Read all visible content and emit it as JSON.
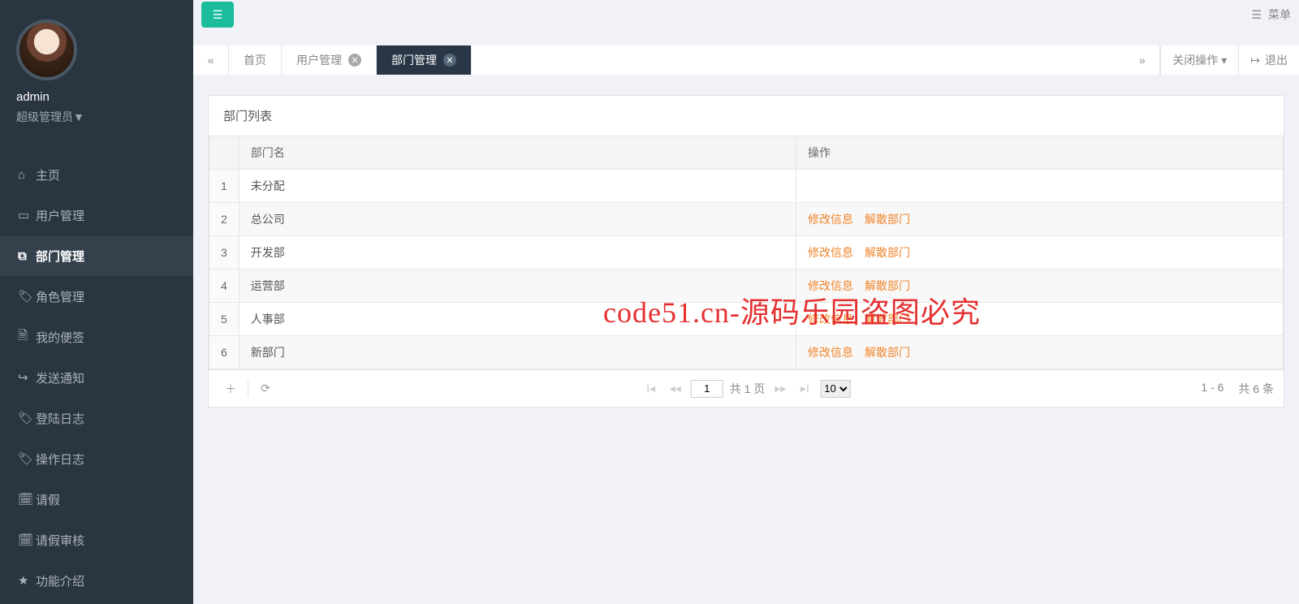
{
  "sidebar": {
    "username": "admin",
    "role": "超级管理员▼",
    "nav": [
      {
        "icon": "⌂",
        "label": "主页"
      },
      {
        "icon": "▭",
        "label": "用户管理"
      },
      {
        "icon": "⧉",
        "label": "部门管理",
        "active": true
      },
      {
        "icon": "🏷",
        "label": "角色管理"
      },
      {
        "icon": "🗎",
        "label": "我的便签"
      },
      {
        "icon": "↪",
        "label": "发送通知"
      },
      {
        "icon": "🏷",
        "label": "登陆日志"
      },
      {
        "icon": "🏷",
        "label": "操作日志"
      },
      {
        "icon": "🗓",
        "label": "请假"
      },
      {
        "icon": "🗓",
        "label": "请假审核"
      },
      {
        "icon": "★",
        "label": "功能介绍"
      }
    ]
  },
  "topright_menu": "菜单",
  "tabs": {
    "items": [
      {
        "label": "首页",
        "closable": false,
        "active": false
      },
      {
        "label": "用户管理",
        "closable": true,
        "active": false
      },
      {
        "label": "部门管理",
        "closable": true,
        "active": true
      }
    ],
    "close_op": "关闭操作",
    "exit": "退出"
  },
  "panel": {
    "title": "部门列表",
    "columns": {
      "name": "部门名",
      "ops": "操作"
    },
    "rows": [
      {
        "idx": "1",
        "name": "未分配",
        "ops": []
      },
      {
        "idx": "2",
        "name": "总公司",
        "ops": [
          "修改信息",
          "解散部门"
        ]
      },
      {
        "idx": "3",
        "name": "开发部",
        "ops": [
          "修改信息",
          "解散部门"
        ]
      },
      {
        "idx": "4",
        "name": "运营部",
        "ops": [
          "修改信息",
          "解散部门"
        ]
      },
      {
        "idx": "5",
        "name": "人事部",
        "ops": [
          "修改信息",
          "解散部门"
        ]
      },
      {
        "idx": "6",
        "name": "新部门",
        "ops": [
          "修改信息",
          "解散部门"
        ]
      }
    ]
  },
  "pager": {
    "page": "1",
    "total_pages": "共 1 页",
    "page_size": "10",
    "range": "1 - 6",
    "total": "共 6 条"
  },
  "watermark": "code51.cn-源码乐园盗图必究"
}
